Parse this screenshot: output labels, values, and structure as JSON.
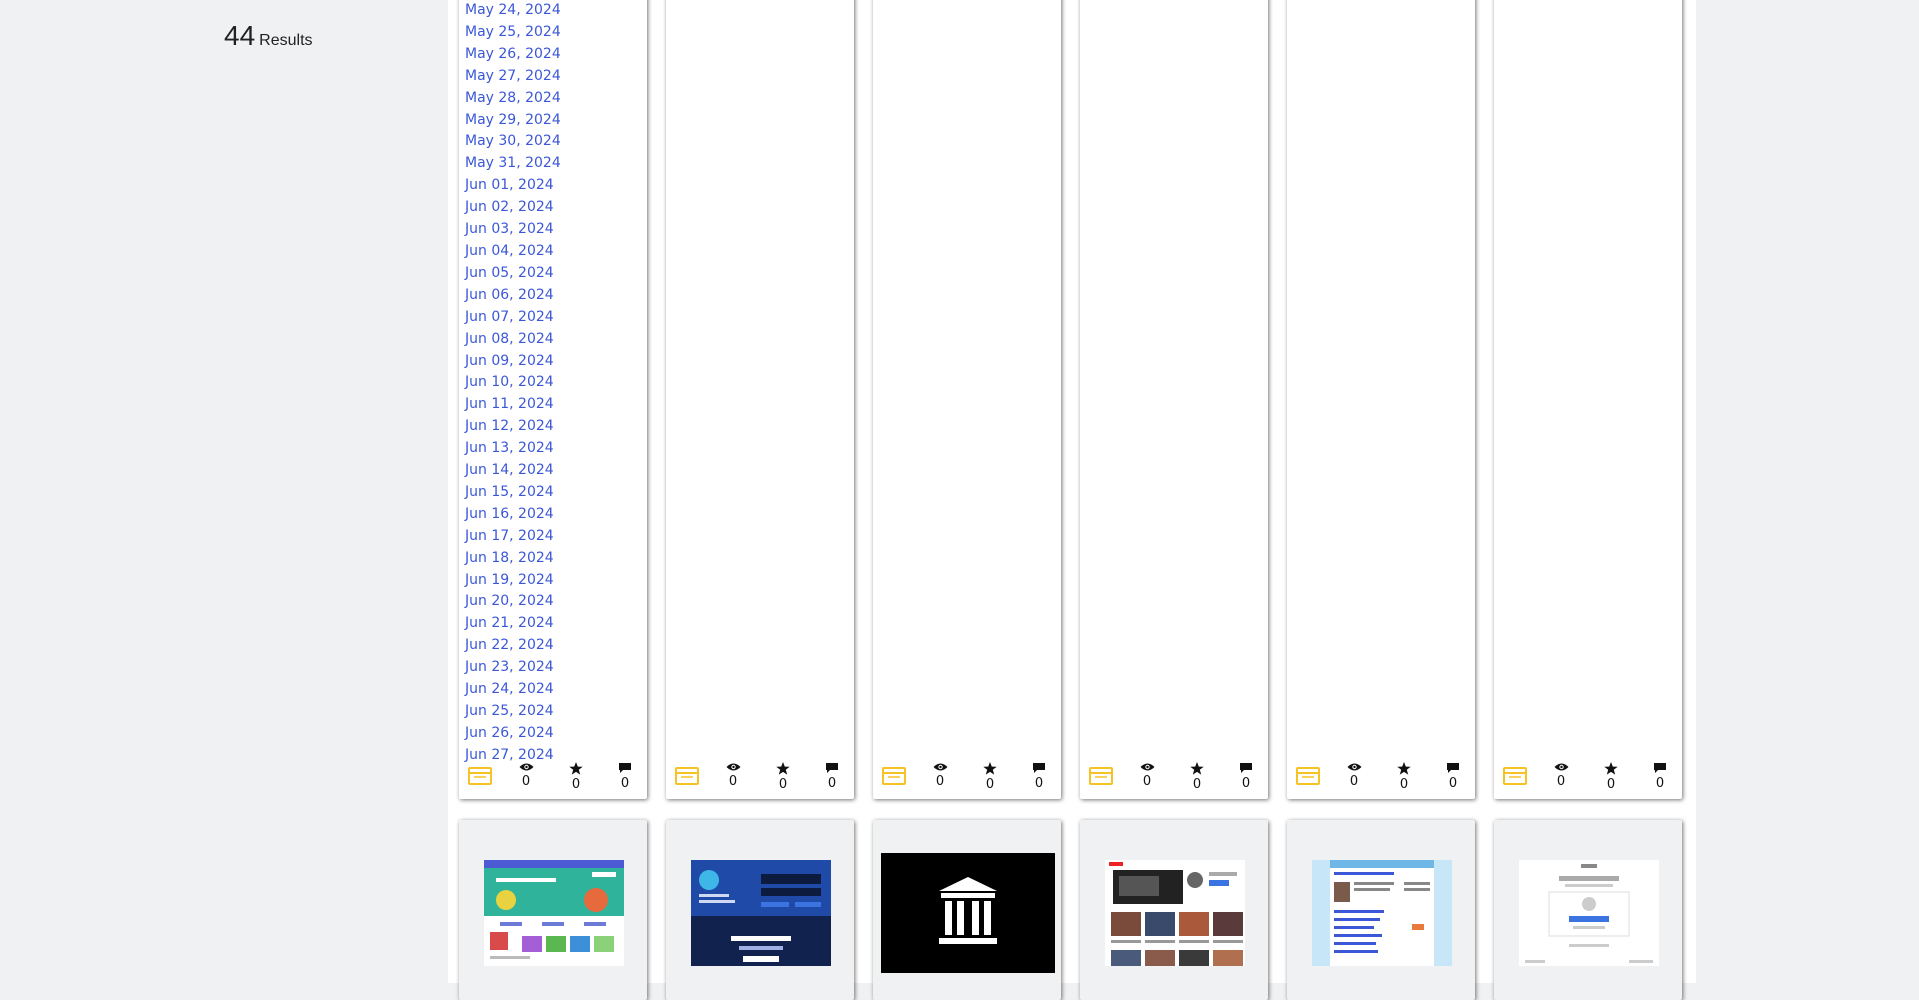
{
  "results": {
    "count": "44",
    "label": "Results"
  },
  "card1_dates": [
    "May 24, 2024",
    "May 25, 2024",
    "May 26, 2024",
    "May 27, 2024",
    "May 28, 2024",
    "May 29, 2024",
    "May 30, 2024",
    "May 31, 2024",
    "Jun 01, 2024",
    "Jun 02, 2024",
    "Jun 03, 2024",
    "Jun 04, 2024",
    "Jun 05, 2024",
    "Jun 06, 2024",
    "Jun 07, 2024",
    "Jun 08, 2024",
    "Jun 09, 2024",
    "Jun 10, 2024",
    "Jun 11, 2024",
    "Jun 12, 2024",
    "Jun 13, 2024",
    "Jun 14, 2024",
    "Jun 15, 2024",
    "Jun 16, 2024",
    "Jun 17, 2024",
    "Jun 18, 2024",
    "Jun 19, 2024",
    "Jun 20, 2024",
    "Jun 21, 2024",
    "Jun 22, 2024",
    "Jun 23, 2024",
    "Jun 24, 2024",
    "Jun 25, 2024",
    "Jun 26, 2024",
    "Jun 27, 2024"
  ],
  "cards": [
    {
      "type_icon": "web-archive-icon",
      "views": "0",
      "favorites": "0",
      "comments": "0"
    },
    {
      "type_icon": "web-archive-icon",
      "views": "0",
      "favorites": "0",
      "comments": "0"
    },
    {
      "type_icon": "web-archive-icon",
      "views": "0",
      "favorites": "0",
      "comments": "0"
    },
    {
      "type_icon": "web-archive-icon",
      "views": "0",
      "favorites": "0",
      "comments": "0"
    },
    {
      "type_icon": "web-archive-icon",
      "views": "0",
      "favorites": "0",
      "comments": "0"
    },
    {
      "type_icon": "web-archive-icon",
      "views": "0",
      "favorites": "0",
      "comments": "0"
    }
  ],
  "thumbnails": [
    {
      "kind": "website-screenshot",
      "theme": "colorful-green"
    },
    {
      "kind": "website-screenshot",
      "theme": "dark-blue"
    },
    {
      "kind": "archive-logo",
      "theme": "black"
    },
    {
      "kind": "website-screenshot",
      "theme": "video-grid"
    },
    {
      "kind": "website-screenshot",
      "theme": "light-blue"
    },
    {
      "kind": "website-screenshot",
      "theme": "google-signin"
    }
  ],
  "colors": {
    "link": "#3b57d8",
    "type_icon": "#f5c323",
    "page_bg": "#f0f1f2",
    "content_bg": "#ffffff"
  }
}
